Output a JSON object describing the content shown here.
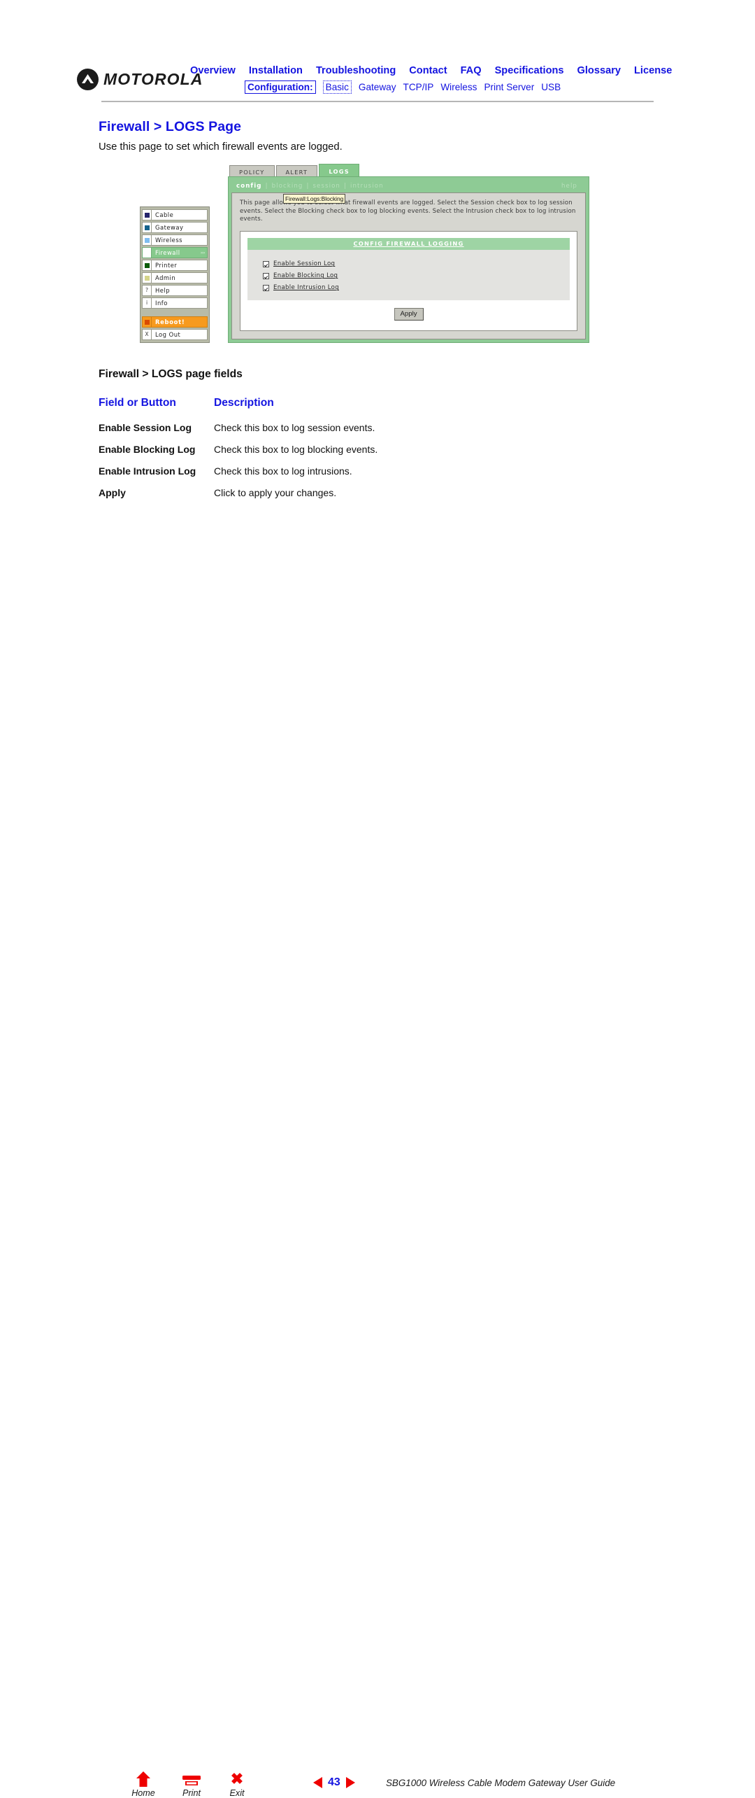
{
  "header": {
    "brand": "MOTOROLA",
    "brand_icon": "motorola-batwing-logo",
    "nav_primary": [
      {
        "label": "Overview"
      },
      {
        "label": "Installation"
      },
      {
        "label": "Troubleshooting"
      },
      {
        "label": "Contact"
      },
      {
        "label": "FAQ"
      },
      {
        "label": "Specifications"
      },
      {
        "label": "Glossary"
      },
      {
        "label": "License"
      }
    ],
    "config_label": "Configuration:",
    "nav_secondary": [
      {
        "label": "Basic",
        "selected": true
      },
      {
        "label": "Gateway",
        "selected": false
      },
      {
        "label": "TCP/IP",
        "selected": false
      },
      {
        "label": "Wireless",
        "selected": false
      },
      {
        "label": "Print Server",
        "selected": false
      },
      {
        "label": "USB",
        "selected": false
      }
    ],
    "accent_color": "#1414e0",
    "rule_color": "#b6b6b6"
  },
  "page": {
    "title": "Firewall > LOGS Page",
    "intro": "Use this page to set which firewall events are logged."
  },
  "screenshot": {
    "tabs": [
      {
        "label": "POLICY",
        "active": false
      },
      {
        "label": "ALERT",
        "active": false
      },
      {
        "label": "LOGS",
        "active": true
      }
    ],
    "crumbs": [
      {
        "label": "config",
        "active": true
      },
      {
        "label": "blocking",
        "active": false
      },
      {
        "label": "session",
        "active": false
      },
      {
        "label": "intrusion",
        "active": false
      }
    ],
    "crumb_separator": "|",
    "help_label": "help",
    "tooltip": "Firewall:Logs:Blocking",
    "description": "This page allows you to select what firewall events are logged. Select the Session check box to log session events. Select the Blocking check box to log blocking events. Select the Intrusion check box to log intrusion events.",
    "card_header": "CONFIG FIREWALL LOGGING",
    "checkboxes": [
      {
        "label": "Enable Session Log",
        "checked": true
      },
      {
        "label": "Enable Blocking Log",
        "checked": true
      },
      {
        "label": "Enable Intrusion Log",
        "checked": true
      }
    ],
    "apply_label": "Apply",
    "sidebar": [
      {
        "label": "Cable",
        "chip_color": "#24246b",
        "glyph": "",
        "selected": false,
        "style": "normal"
      },
      {
        "label": "Gateway",
        "chip_color": "#14628c",
        "glyph": "",
        "selected": false,
        "style": "normal"
      },
      {
        "label": "Wireless",
        "chip_color": "#7fbdf0",
        "glyph": "",
        "selected": false,
        "style": "normal"
      },
      {
        "label": "Firewall",
        "chip_color": "#ffffff",
        "glyph": "",
        "selected": true,
        "style": "normal",
        "arrow": "›››"
      },
      {
        "label": "Printer",
        "chip_color": "#0a5c0a",
        "glyph": "",
        "selected": false,
        "style": "normal"
      },
      {
        "label": "Admin",
        "chip_color": "#d4d48a",
        "glyph": "",
        "selected": false,
        "style": "normal"
      },
      {
        "label": "Help",
        "chip_color": "",
        "glyph": "?",
        "selected": false,
        "style": "normal"
      },
      {
        "label": "Info",
        "chip_color": "",
        "glyph": "i",
        "selected": false,
        "style": "normal"
      },
      {
        "label": "Reboot!",
        "chip_color": "#d94a00",
        "glyph": "",
        "selected": false,
        "style": "reboot"
      },
      {
        "label": "Log Out",
        "chip_color": "",
        "glyph": "X",
        "selected": false,
        "style": "normal"
      }
    ],
    "panel_color": "#8ecb95",
    "accent_color": "#9ed4a4",
    "reboot_color": "#f79a1e"
  },
  "fields": {
    "title": "Firewall > LOGS page fields",
    "columns": {
      "c1": "Field or Button",
      "c2": "Description"
    },
    "rows": [
      {
        "field": "Enable Session Log",
        "description": "Check this box to log session events."
      },
      {
        "field": "Enable Blocking Log",
        "description": "Check this box to log blocking events."
      },
      {
        "field": "Enable Intrusion Log",
        "description": "Check this box to log intrusions."
      },
      {
        "field": "Apply",
        "description": "Click to apply your changes."
      }
    ]
  },
  "footer": {
    "home_label": "Home",
    "home_icon": "home-icon",
    "print_label": "Print",
    "print_icon": "printer-icon",
    "exit_label": "Exit",
    "exit_icon": "close-x-icon",
    "prev_icon": "triangle-left-icon",
    "next_icon": "triangle-right-icon",
    "page_number": "43",
    "doc_title": "SBG1000 Wireless Cable Modem Gateway User Guide",
    "icon_color": "#ee0000"
  }
}
